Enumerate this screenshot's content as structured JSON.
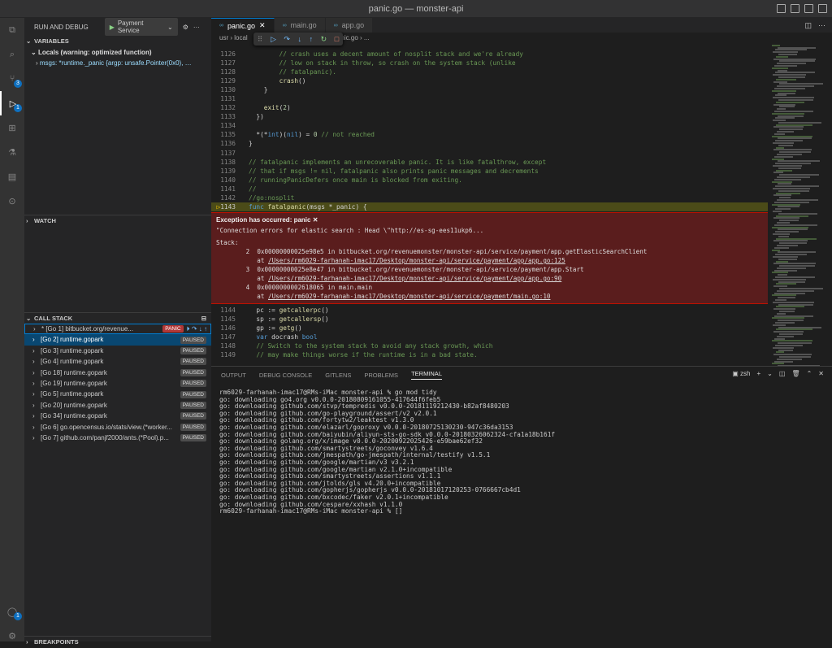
{
  "window": {
    "title": "panic.go — monster-api"
  },
  "sidebar": {
    "header": "RUN AND DEBUG",
    "config": "Payment Service",
    "variables_title": "VARIABLES",
    "locals_label": "Locals (warning: optimized function)",
    "locals_var": "msgs: *runtime._panic {argp: unsafe.Pointer(0x0), …",
    "watch_title": "WATCH",
    "callstack_title": "CALL STACK",
    "breakpoints_title": "BREAKPOINTS",
    "panic_badge": "PANIC",
    "paused_label": "PAUSED",
    "callstack": [
      {
        "label": "* [Go 1] bitbucket.org/revenue...",
        "state": "PANIC"
      },
      {
        "label": "[Go 2] runtime.gopark",
        "state": "PAUSED"
      },
      {
        "label": "[Go 3] runtime.gopark",
        "state": "PAUSED"
      },
      {
        "label": "[Go 4] runtime.gopark",
        "state": "PAUSED"
      },
      {
        "label": "[Go 18] runtime.gopark",
        "state": "PAUSED"
      },
      {
        "label": "[Go 19] runtime.gopark",
        "state": "PAUSED"
      },
      {
        "label": "[Go 5] runtime.gopark",
        "state": "PAUSED"
      },
      {
        "label": "[Go 20] runtime.gopark",
        "state": "PAUSED"
      },
      {
        "label": "[Go 34] runtime.gopark",
        "state": "PAUSED"
      },
      {
        "label": "[Go 6] go.opencensus.io/stats/view.(*worker...",
        "state": "PAUSED"
      },
      {
        "label": "[Go 7] github.com/panjf2000/ants.(*Pool).p...",
        "state": "PAUSED"
      }
    ]
  },
  "activity": {
    "scm_badge": "3",
    "debug_badge": "1",
    "account_badge": "1"
  },
  "tabs": [
    {
      "label": "panic.go",
      "active": true
    },
    {
      "label": "main.go",
      "active": false
    },
    {
      "label": "app.go",
      "active": false
    }
  ],
  "breadcrumb": {
    "pre": "usr › local",
    "post": "anic.go › ..."
  },
  "code_top": [
    {
      "ln": "1126",
      "text": "        // crash uses a decent amount of nosplit stack and we're already"
    },
    {
      "ln": "1127",
      "text": "        // low on stack in throw, so crash on the system stack (unlike"
    },
    {
      "ln": "1128",
      "text": "        // fatalpanic)."
    },
    {
      "ln": "1129",
      "text": "        crash()"
    },
    {
      "ln": "1130",
      "text": "    }"
    },
    {
      "ln": "1131",
      "text": ""
    },
    {
      "ln": "1132",
      "text": "    exit(2)"
    },
    {
      "ln": "1133",
      "text": "  })"
    },
    {
      "ln": "1134",
      "text": ""
    },
    {
      "ln": "1135",
      "text": "  *(*int)(nil) = 0 // not reached"
    },
    {
      "ln": "1136",
      "text": "}"
    },
    {
      "ln": "1137",
      "text": ""
    },
    {
      "ln": "1138",
      "text": "// fatalpanic implements an unrecoverable panic. It is like fatalthrow, except"
    },
    {
      "ln": "1139",
      "text": "// that if msgs != nil, fatalpanic also prints panic messages and decrements"
    },
    {
      "ln": "1140",
      "text": "// runningPanicDefers once main is blocked from exiting."
    },
    {
      "ln": "1141",
      "text": "//"
    },
    {
      "ln": "1142",
      "text": "//go:nosplit"
    },
    {
      "ln": "1143",
      "text": "func fatalpanic(msgs *_panic) {"
    }
  ],
  "exception": {
    "title": "Exception has occurred: panic",
    "message": "\"Connection errors for elastic search : Head \\\"http://es-sg-ees11ukp6...",
    "stack_label": "Stack:",
    "frames": [
      {
        "n": "2",
        "addr": "0x00000000025e98e5 in bitbucket.org/revenuemonster/monster-api/service/payment/app.getElasticSearchClient",
        "at": "/Users/rm6029-farhanah-imac17/Desktop/monster-api/service/payment/app/app.go:125"
      },
      {
        "n": "3",
        "addr": "0x00000000025e8e47 in bitbucket.org/revenuemonster/monster-api/service/payment/app.Start",
        "at": "/Users/rm6029-farhanah-imac17/Desktop/monster-api/service/payment/app/app.go:90"
      },
      {
        "n": "4",
        "addr": "0x0000000002618065 in main.main",
        "at": "/Users/rm6029-farhanah-imac17/Desktop/monster-api/service/payment/main.go:10"
      }
    ]
  },
  "code_bottom": [
    {
      "ln": "1144",
      "text": "  pc := getcallerpc()"
    },
    {
      "ln": "1145",
      "text": "  sp := getcallersp()"
    },
    {
      "ln": "1146",
      "text": "  gp := getg()"
    },
    {
      "ln": "1147",
      "text": "  var docrash bool"
    },
    {
      "ln": "1148",
      "text": "  // Switch to the system stack to avoid any stack growth, which"
    },
    {
      "ln": "1149",
      "text": "  // may make things worse if the runtime is in a bad state."
    }
  ],
  "panel": {
    "tabs": [
      "OUTPUT",
      "DEBUG CONSOLE",
      "GITLENS",
      "PROBLEMS",
      "TERMINAL"
    ],
    "active_tab": "TERMINAL",
    "shell": "zsh",
    "terminal_lines": [
      "rm6029-farhanah-imac17@RMs-iMac monster-api % go mod tidy",
      "go: downloading go4.org v0.0.0-20180809161055-417644f6feb5",
      "go: downloading github.com/stvp/tempredis v0.0.0-20181119212430-b82af8480203",
      "go: downloading github.com/go-playground/assert/v2 v2.0.1",
      "go: downloading github.com/fortytw2/leaktest v1.3.0",
      "go: downloading github.com/elazarl/goproxy v0.0.0-20180725130230-947c36da3153",
      "go: downloading github.com/baiyubin/aliyun-sts-go-sdk v0.0.0-20180326062324-cfa1a18b161f",
      "go: downloading golang.org/x/image v0.0.0-20200922025426-e59bae62ef32",
      "go: downloading github.com/smartystreets/goconvey v1.6.4",
      "go: downloading github.com/jmespath/go-jmespath/internal/testify v1.5.1",
      "go: downloading github.com/google/martian/v3 v3.2.1",
      "go: downloading github.com/google/martian v2.1.0+incompatible",
      "go: downloading github.com/smartystreets/assertions v1.1.1",
      "go: downloading github.com/jtolds/gls v4.20.0+incompatible",
      "go: downloading github.com/gopherjs/gopherjs v0.0.0-20181017120253-0766667cb4d1",
      "go: downloading github.com/bxcodec/faker v2.0.1+incompatible",
      "go: downloading github.com/cespare/xxhash v1.1.0",
      "rm6029-farhanah-imac17@RMs-iMac monster-api % []"
    ]
  }
}
